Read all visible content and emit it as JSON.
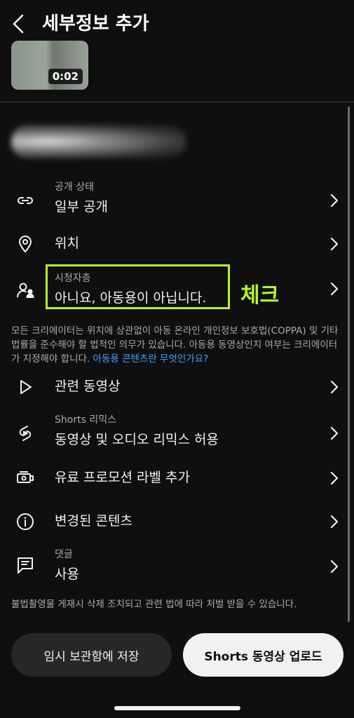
{
  "header": {
    "title": "세부정보 추가"
  },
  "thumbnail": {
    "duration": "0:02"
  },
  "rows": [
    {
      "id": "visibility",
      "sub": "공개 상태",
      "main": "일부 공개",
      "icon": "link-icon"
    },
    {
      "id": "location",
      "sub": "",
      "main": "위치",
      "icon": "location-pin-icon"
    },
    {
      "id": "audience",
      "sub": "시청자층",
      "main": "아니요, 아동용이 아닙니다.",
      "icon": "audience-icon"
    },
    {
      "id": "related",
      "sub": "",
      "main": "관련 동영상",
      "icon": "play-icon"
    },
    {
      "id": "remix",
      "sub": "Shorts 리믹스",
      "main": "동영상 및 오디오 리믹스 허용",
      "icon": "shorts-remix-icon"
    },
    {
      "id": "promotion",
      "sub": "",
      "main": "유료 프로모션 라벨 추가",
      "icon": "paid-promotion-icon"
    },
    {
      "id": "altered",
      "sub": "",
      "main": "변경된 콘텐츠",
      "icon": "info-icon"
    },
    {
      "id": "comments",
      "sub": "댓글",
      "main": "사용",
      "icon": "comment-icon"
    }
  ],
  "annotation": {
    "check_label": "체크",
    "color": "#b6f52a"
  },
  "notice": {
    "text": "모든 크리에이터는 위치에 상관없이 아동 온라인 개인정보 보호법(COPPA) 및 기타 법률을 준수해야 할 법적인 의무가 있습니다. 아동용 동영상인지 여부는 크리에이터가 지정해야 합니다. ",
    "link": "아동용 콘텐츠란 무엇인가요?"
  },
  "footer_note": "불법촬영물 게재시 삭제 조치되고 관련 법에 따라 처벌 받을 수 있습니다.",
  "buttons": {
    "save": "임시 보관함에 저장",
    "upload": "Shorts 동영상 업로드"
  },
  "colors": {
    "background": "#0f0f0f",
    "link": "#3ea6ff",
    "upload_button": "#f1f1f1"
  }
}
